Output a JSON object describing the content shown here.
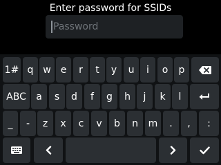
{
  "header": {
    "title": "Enter password for SSIDs"
  },
  "password_field": {
    "placeholder": "Password",
    "value": ""
  },
  "keyboard": {
    "row1": [
      "1#",
      "q",
      "w",
      "e",
      "r",
      "t",
      "y",
      "u",
      "i",
      "o",
      "p"
    ],
    "row2": [
      "ABC",
      "a",
      "s",
      "d",
      "f",
      "g",
      "h",
      "j",
      "k",
      "l"
    ],
    "row3": [
      "_",
      "-",
      "z",
      "x",
      "c",
      "v",
      "b",
      "n",
      "m",
      ".",
      ",",
      ":"
    ],
    "icons": {
      "backspace": "backspace-icon",
      "enter": "enter-icon",
      "keyboard": "keyboard-icon",
      "left": "chevron-left-icon",
      "right": "chevron-right-icon",
      "ok": "checkmark-icon"
    }
  },
  "colors": {
    "background": "#000000",
    "keyboard_bg": "#101214",
    "key_bg": "#2b2f33",
    "text": "#ffffff"
  }
}
